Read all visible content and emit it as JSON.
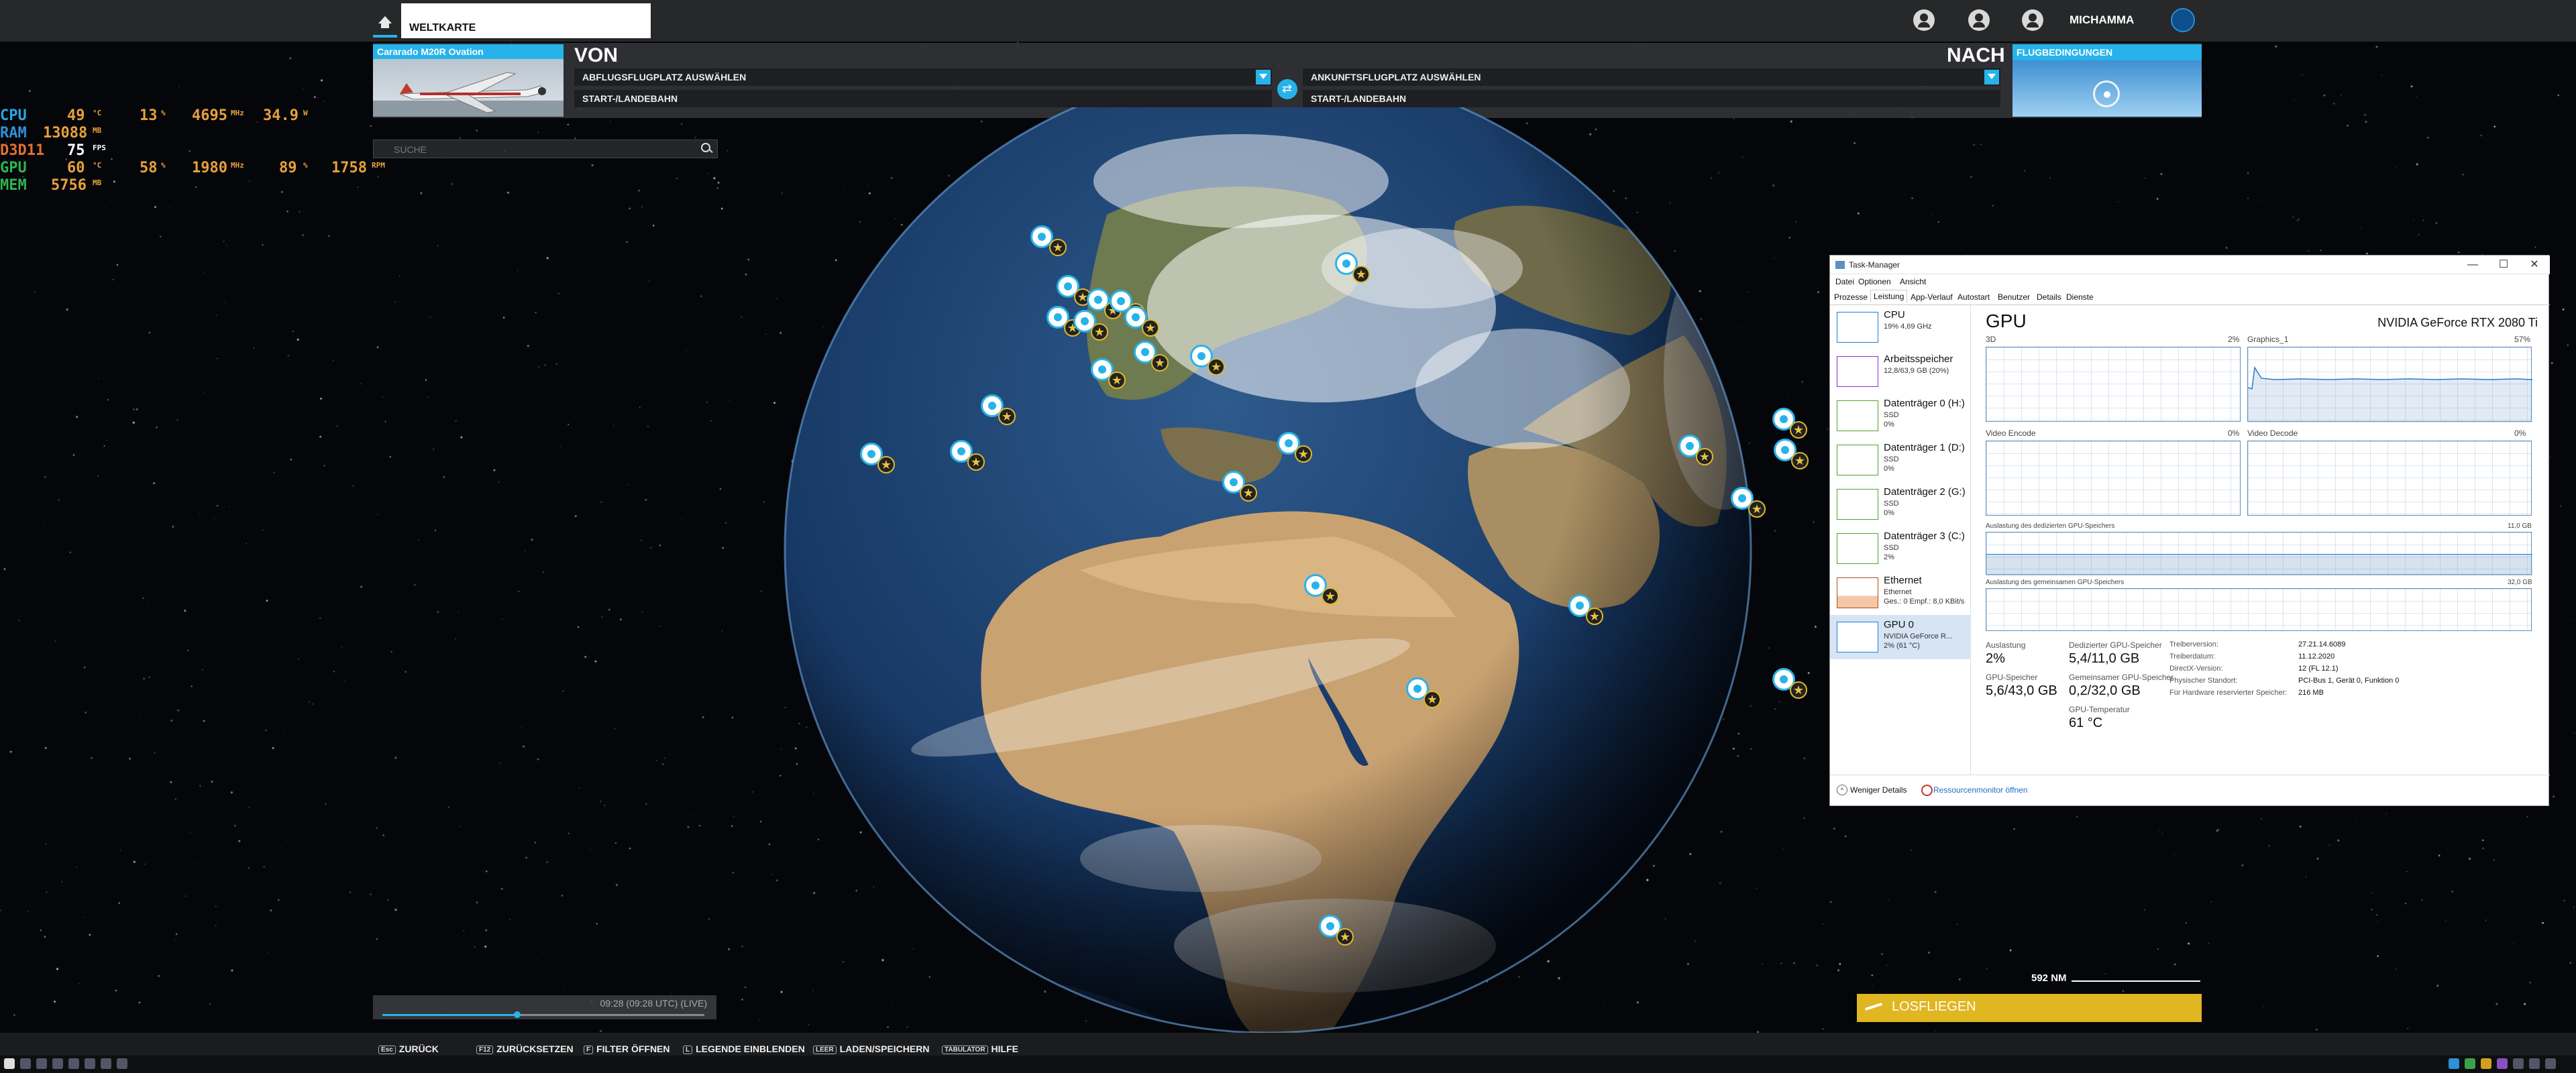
{
  "topbar": {
    "home_icon": "home-icon",
    "tab_label": "WELTKARTE",
    "username": "MICHAMMA",
    "icons": [
      "friends-icon",
      "profile-icon",
      "user-icon",
      "globe-icon"
    ]
  },
  "planner": {
    "aircraft_name": "Cararado M20R Ovation",
    "from_title": "VON",
    "to_title": "NACH",
    "departure_placeholder": "ABFLUGSFLUGPLATZ AUSWÄHLEN",
    "arrival_placeholder": "ANKUNFTSFLUGPLATZ AUSWÄHLEN",
    "runway_label": "START-/LANDEBAHN",
    "conditions_title": "FLUGBEDINGUNGEN"
  },
  "stats": {
    "cpu": {
      "label": "CPU",
      "temp": "49",
      "temp_unit": "°C",
      "load": "13",
      "load_unit": "%",
      "clock": "4695",
      "clock_unit": "MHz",
      "power": "34.9",
      "power_unit": "W"
    },
    "ram": {
      "label": "RAM",
      "value": "13088",
      "unit": "MB"
    },
    "d3d": {
      "label": "D3D11",
      "value": "75",
      "unit": "FPS"
    },
    "gpu": {
      "label": "GPU",
      "temp": "60",
      "temp_unit": "°C",
      "load": "58",
      "load_unit": "%",
      "clock": "1980",
      "clock_unit": "MHz",
      "fan": "89",
      "fan_unit": "%",
      "rpm": "1758",
      "rpm_unit": "RPM"
    },
    "mem": {
      "label": "MEM",
      "value": "5756",
      "unit": "MB"
    },
    "colors": {
      "cpu": "#27a7e8",
      "ram": "#2f8fd8",
      "d3d": "#e07030",
      "gpu": "#2fb34f",
      "mem": "#2fb34f",
      "value": "#e8a13a"
    }
  },
  "search": {
    "placeholder": "SUCHE"
  },
  "taskmanager": {
    "title": "Task-Manager",
    "menu": [
      "Datei",
      "Optionen",
      "Ansicht"
    ],
    "tabs": [
      "Prozesse",
      "Leistung",
      "App-Verlauf",
      "Autostart",
      "Benutzer",
      "Details",
      "Dienste"
    ],
    "sidebar": [
      {
        "name": "CPU",
        "l2": "19% 4,69 GHz",
        "l3": ""
      },
      {
        "name": "Arbeitsspeicher",
        "l2": "12,8/63,9 GB (20%)",
        "l3": ""
      },
      {
        "name": "Datenträger 0 (H:)",
        "l2": "SSD",
        "l3": "0%"
      },
      {
        "name": "Datenträger 1 (D:)",
        "l2": "SSD",
        "l3": "0%"
      },
      {
        "name": "Datenträger 2 (G:)",
        "l2": "SSD",
        "l3": "0%"
      },
      {
        "name": "Datenträger 3 (C:)",
        "l2": "SSD",
        "l3": "2%"
      },
      {
        "name": "Ethernet",
        "l2": "Ethernet",
        "l3": "Ges.: 0 Empf.: 8,0 KBit/s"
      },
      {
        "name": "GPU 0",
        "l2": "NVIDIA GeForce R...",
        "l3": "2% (61 °C)"
      }
    ],
    "main": {
      "title": "GPU",
      "model": "NVIDIA GeForce RTX 2080 Ti",
      "graphs": {
        "g3d": {
          "label": "3D",
          "pct": "2%"
        },
        "graphics1": {
          "label": "Graphics_1",
          "pct": "57%"
        },
        "venc": {
          "label": "Video Encode",
          "pct": "0%"
        },
        "vdec": {
          "label": "Video Decode",
          "pct": "0%"
        },
        "dedicated": {
          "label": "Auslastung des dedizierten GPU-Speichers",
          "max": "11,0 GB"
        },
        "shared": {
          "label": "Auslastung des gemeinsamen GPU-Speichers",
          "max": "32,0 GB"
        }
      },
      "stats": {
        "util_label": "Auslastung",
        "util_value": "2%",
        "ded_label": "Dedizierter GPU-Speicher",
        "ded_value": "5,4/11,0 GB",
        "gpumem_label": "GPU-Speicher",
        "gpumem_value": "5,6/43,0 GB",
        "shared_label": "Gemeinsamer GPU-Speicher",
        "shared_value": "0,2/32,0 GB",
        "temp_label": "GPU-Temperatur",
        "temp_value": "61 °C"
      },
      "details": [
        {
          "label": "Treiberversion:",
          "value": "27.21.14.6089"
        },
        {
          "label": "Treiberdatum:",
          "value": "11.12.2020"
        },
        {
          "label": "DirectX-Version:",
          "value": "12 (FL 12.1)"
        },
        {
          "label": "Physischer Standort:",
          "value": "PCI-Bus 1, Gerät 0, Funktion 0"
        },
        {
          "label": "Für Hardware reservierter Speicher:",
          "value": "216 MB"
        }
      ]
    },
    "footer": {
      "fewer": "Weniger Details",
      "resmon": "Ressourcenmonitor öffnen"
    }
  },
  "map": {
    "time": "09:28 (09:28 UTC) (LIVE)",
    "scale": "592 NM",
    "takeoff": "LOSFLIEGEN"
  },
  "bottom": {
    "hints": [
      {
        "key": "Esc",
        "label": "ZURÜCK"
      },
      {
        "key": "F12",
        "label": "ZURÜCKSETZEN"
      },
      {
        "key": "F",
        "label": "FILTER ÖFFNEN"
      },
      {
        "key": "L",
        "label": "LEGENDE EINBLENDEN"
      },
      {
        "key": "LEER",
        "label": "LADEN/SPEICHERN"
      },
      {
        "key": "TABULATOR",
        "label": "HILFE"
      }
    ]
  }
}
